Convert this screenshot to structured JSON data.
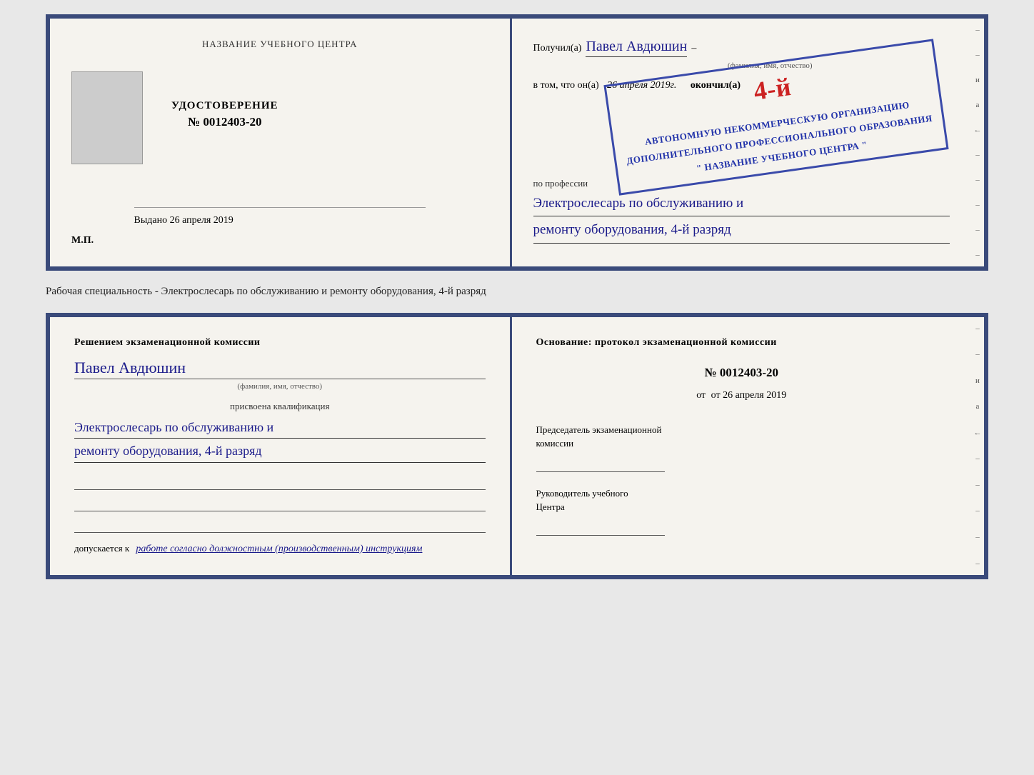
{
  "top_booklet": {
    "left": {
      "title": "НАЗВАНИЕ УЧЕБНОГО ЦЕНТРА",
      "cert_label": "УДОСТОВЕРЕНИЕ",
      "cert_number": "№ 0012403-20",
      "issued_text": "Выдано 26 апреля 2019",
      "mp_label": "М.П."
    },
    "right": {
      "received_prefix": "Получил(а)",
      "received_name": "Павел Авдюшин",
      "fio_label": "(фамилия, имя, отчество)",
      "vtom_text": "в том, что он(а)",
      "date_text": "26 апреля 2019г.",
      "finished_text": "окончил(а)",
      "stamp_grade": "4-й",
      "stamp_line1": "АВТОНОМНУЮ НЕКОММЕРЧЕСКУЮ ОРГАНИЗАЦИЮ",
      "stamp_line2": "ДОПОЛНИТЕЛЬНОГО ПРОФЕССИОНАЛЬНОГО ОБРАЗОВАНИЯ",
      "stamp_line3": "\" НАЗВАНИЕ УЧЕБНОГО ЦЕНТРА \"",
      "profession_label": "по профессии",
      "profession_line1": "Электрослесарь по обслуживанию и",
      "profession_line2": "ремонту оборудования, 4-й разряд"
    }
  },
  "caption": {
    "text": "Рабочая специальность - Электрослесарь по обслуживанию и ремонту оборудования, 4-й разряд"
  },
  "bottom_booklet": {
    "left": {
      "decision_title": "Решением экзаменационной  комиссии",
      "name_value": "Павел Авдюшин",
      "fio_label": "(фамилия, имя, отчество)",
      "assigned_label": "присвоена квалификация",
      "qualification_line1": "Электрослесарь по обслуживанию и",
      "qualification_line2": "ремонту оборудования, 4-й разряд",
      "допускается_prefix": "допускается к",
      "допускается_value": "работе согласно должностным (производственным) инструкциям"
    },
    "right": {
      "osnov_title": "Основание: протокол экзаменационной  комиссии",
      "protocol_number": "№  0012403-20",
      "ot_text": "от 26 апреля 2019",
      "chair_label1": "Председатель экзаменационной",
      "chair_label2": "комиссии",
      "head_label1": "Руководитель учебного",
      "head_label2": "Центра"
    }
  },
  "side_items": [
    "и",
    "а",
    "←",
    "–",
    "–",
    "–",
    "–",
    "–"
  ]
}
